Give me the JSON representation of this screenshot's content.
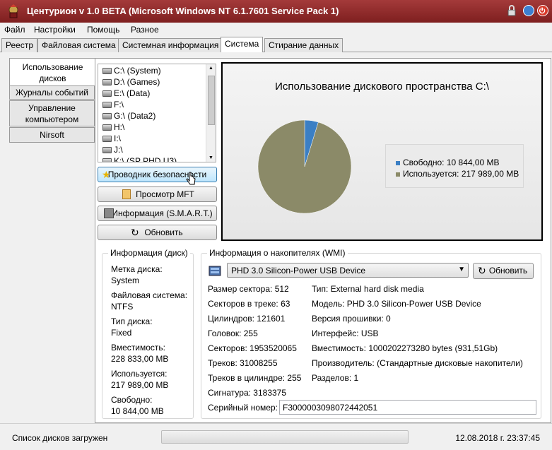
{
  "window": {
    "title": "Центурион v 1.0 BETA (Microsoft Windows NT 6.1.7601 Service Pack 1)",
    "accent": "#8a2a2a"
  },
  "menu": [
    "Файл",
    "Настройки",
    "Помощь",
    "Разное"
  ],
  "tabs": [
    "Реестр",
    "Файловая система",
    "Системная информация",
    "Система",
    "Стирание данных"
  ],
  "active_tab": "Система",
  "side_tabs": [
    "Использование дисков",
    "Журналы событий",
    "Управление компьютером",
    "Nirsoft"
  ],
  "drives": [
    {
      "label": "C:\\  (System)",
      "icon": "drive-icon"
    },
    {
      "label": "D:\\  (Games)",
      "icon": "drive-icon"
    },
    {
      "label": "E:\\  (Data)",
      "icon": "drive-icon"
    },
    {
      "label": "F:\\",
      "icon": "drive-icon"
    },
    {
      "label": "G:\\  (Data2)",
      "icon": "drive-icon"
    },
    {
      "label": "H:\\",
      "icon": "drive-icon"
    },
    {
      "label": "I:\\",
      "icon": "drive-icon"
    },
    {
      "label": "J:\\",
      "icon": "drive-icon"
    },
    {
      "label": "K:\\  (SP PHD U3)",
      "icon": "drive-icon"
    }
  ],
  "buttons": {
    "security_explorer": "Проводник безопасности",
    "mft_view": "Просмотр MFT",
    "smart_info": "Информация (S.M.A.R.T.)",
    "refresh": "Обновить"
  },
  "chart_data": {
    "type": "pie",
    "title": "Использование дискового пространства C:\\",
    "legend_position": "right",
    "slices": [
      {
        "label": "Свободно: 10 844,00 MB",
        "value": 10844.0,
        "color": "#3b7fc4"
      },
      {
        "label": "Используется: 217 989,00 MB",
        "value": 217989.0,
        "color": "#8b8a68"
      }
    ]
  },
  "disk_info": {
    "title": "Информация (диск)",
    "items": [
      {
        "label": "Метка диска:",
        "value": "System"
      },
      {
        "label": "Файловая система:",
        "value": "NTFS"
      },
      {
        "label": "Тип диска:",
        "value": "Fixed"
      },
      {
        "label": "Вместимость:",
        "value": "228 833,00 MB"
      },
      {
        "label": "Используется:",
        "value": "217 989,00 MB"
      },
      {
        "label": "Свободно:",
        "value": "10 844,00 MB"
      }
    ]
  },
  "wmi": {
    "title": "Информация о накопителях (WMI)",
    "device": "PHD 3.0 Silicon-Power USB Device",
    "refresh": "Обновить",
    "left": [
      "Размер сектора: 512",
      "Секторов в треке: 63",
      "Цилиндров: 121601",
      "Головок: 255",
      "Секторов: 1953520065",
      "Треков: 31008255",
      "Треков в цилиндре: 255",
      "Сигнатура: 3183375"
    ],
    "right": [
      "Тип: External hard disk media",
      "Модель: PHD 3.0 Silicon-Power USB Device",
      "Версия прошивки: 0",
      "Интерфейс: USB",
      "Вместимость: 1000202273280 bytes (931,51Gb)",
      "Производитель: (Стандартные дисковые накопители)",
      "Разделов: 1"
    ],
    "serial_label": "Серийный номер:",
    "serial_value": "F3000003098072442051"
  },
  "status": {
    "text": "Список дисков загружен",
    "datetime": "12.08.2018 г. 23:37:45"
  }
}
